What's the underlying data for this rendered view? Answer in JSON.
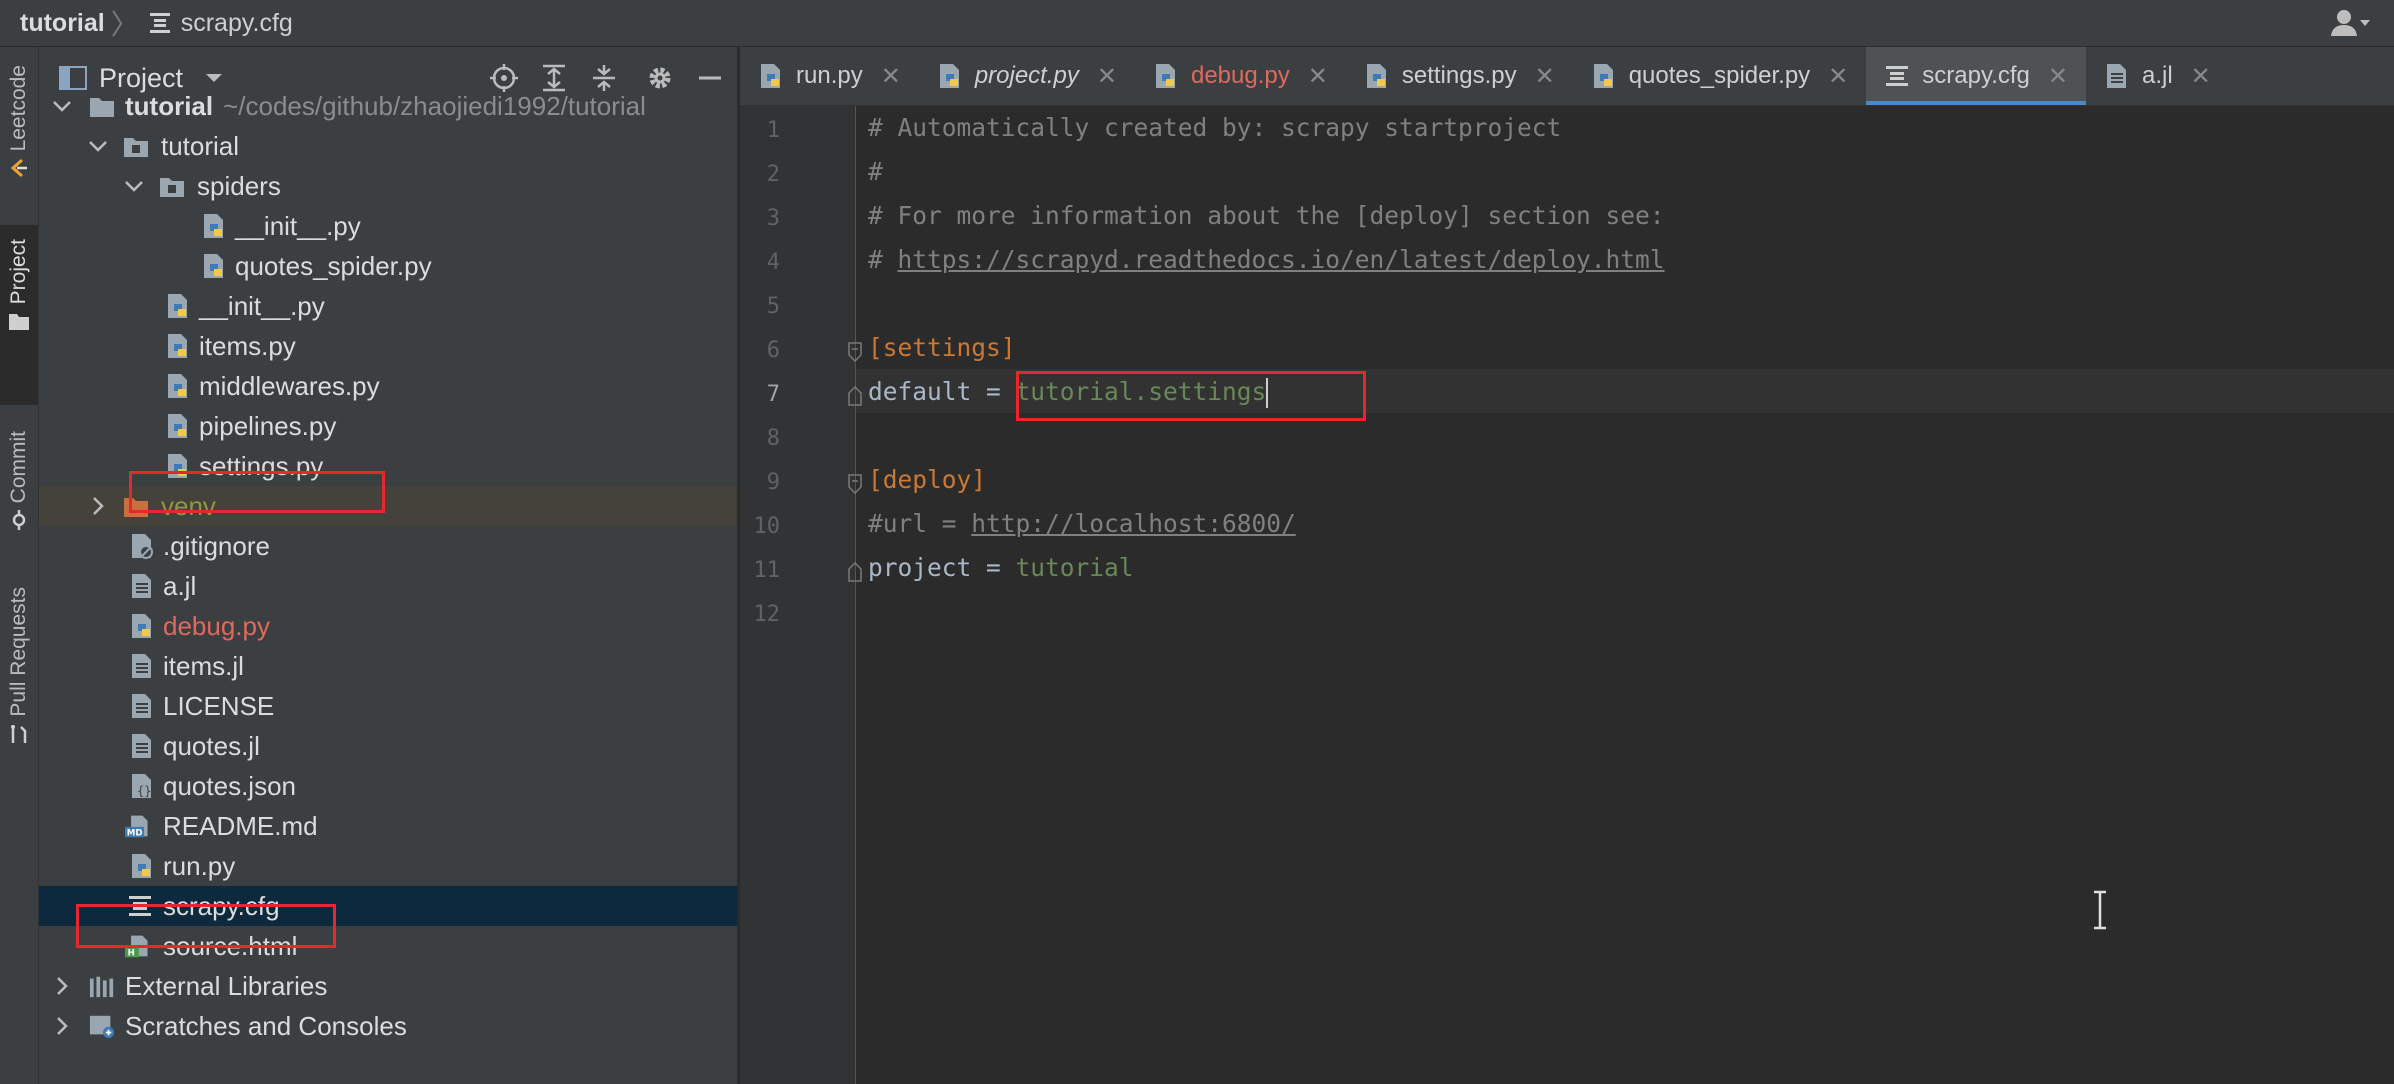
{
  "breadcrumb": {
    "root": "tutorial",
    "file": "scrapy.cfg"
  },
  "stripe": {
    "leetcode": "Leetcode",
    "project": "Project",
    "commit": "Commit",
    "pull_requests": "Pull Requests"
  },
  "project_panel": {
    "title": "Project",
    "tree": [
      {
        "label": "tutorial",
        "path": "~/codes/github/zhaojiedi1992/tutorial",
        "type": "folder",
        "expanded": true
      },
      {
        "label": "tutorial",
        "type": "folder",
        "expanded": true
      },
      {
        "label": "spiders",
        "type": "folder",
        "expanded": true
      },
      {
        "label": "__init__.py",
        "type": "python"
      },
      {
        "label": "quotes_spider.py",
        "type": "python"
      },
      {
        "label": "__init__.py",
        "type": "python"
      },
      {
        "label": "items.py",
        "type": "python"
      },
      {
        "label": "middlewares.py",
        "type": "python"
      },
      {
        "label": "pipelines.py",
        "type": "python"
      },
      {
        "label": "settings.py",
        "type": "python"
      },
      {
        "label": "venv",
        "type": "excluded-folder",
        "expanded": false
      },
      {
        "label": ".gitignore",
        "type": "file"
      },
      {
        "label": "a.jl",
        "type": "file"
      },
      {
        "label": "debug.py",
        "type": "python"
      },
      {
        "label": "items.jl",
        "type": "file"
      },
      {
        "label": "LICENSE",
        "type": "file"
      },
      {
        "label": "quotes.jl",
        "type": "file"
      },
      {
        "label": "quotes.json",
        "type": "json"
      },
      {
        "label": "README.md",
        "type": "markdown"
      },
      {
        "label": "run.py",
        "type": "python"
      },
      {
        "label": "scrapy.cfg",
        "type": "config",
        "selected": true
      },
      {
        "label": "source.html",
        "type": "html"
      },
      {
        "label": "External Libraries",
        "type": "library",
        "expanded": false
      },
      {
        "label": "Scratches and Consoles",
        "type": "scratches",
        "expanded": false
      }
    ]
  },
  "tabs": [
    {
      "label": "run.py",
      "icon": "python-file-icon"
    },
    {
      "label": "project.py",
      "icon": "python-file-icon",
      "italic": true
    },
    {
      "label": "debug.py",
      "icon": "python-file-icon",
      "color": "#e0695d"
    },
    {
      "label": "settings.py",
      "icon": "python-file-icon"
    },
    {
      "label": "quotes_spider.py",
      "icon": "python-file-icon"
    },
    {
      "label": "scrapy.cfg",
      "icon": "config-file-icon",
      "active": true
    },
    {
      "label": "a.jl",
      "icon": "text-file-icon"
    }
  ],
  "editor": {
    "line_numbers": [
      "1",
      "2",
      "3",
      "4",
      "5",
      "6",
      "7",
      "8",
      "9",
      "10",
      "11",
      "12"
    ],
    "current_line": "7",
    "lines": {
      "l1": "# Automatically created by: scrapy startproject",
      "l2": "#",
      "l3": "# For more information about the [deploy] section see:",
      "l4_prefix": "# ",
      "l4_link": "https://scrapyd.readthedocs.io/en/latest/deploy.html",
      "l6": "[settings]",
      "l7_key": "default = ",
      "l7_value": "tutorial.settings",
      "l9": "[deploy]",
      "l10_key": "#url = ",
      "l10_link": "http://localhost:6800/",
      "l11_key": "project = ",
      "l11_value": "tutorial"
    }
  },
  "colors": {
    "highlight_box": "#e8262e",
    "selection": "#0d293e",
    "active_tab_underline": "#4a88c7",
    "section": "#cc7832",
    "value": "#6a8759"
  }
}
